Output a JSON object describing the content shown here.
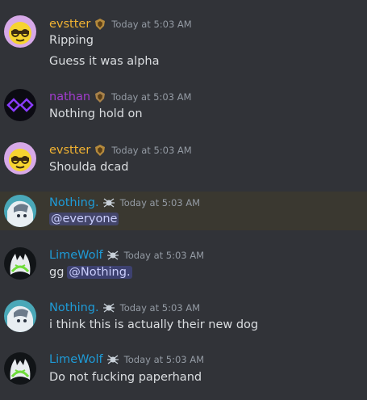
{
  "colors": {
    "background": "#313338",
    "mention_highlight": "#3a3830",
    "mention_pill_bg": "#3c4270",
    "mention_text": "#c9cdfb",
    "evstter": "#f0b232",
    "nathan": "#a23cce",
    "nothing": "#1e9bd7",
    "limewolf": "#1e9bd7",
    "timestamp": "#949ba4",
    "text": "#dbdee1"
  },
  "messages": [
    {
      "user": "evstter",
      "timestamp": "Today at 5:03 AM",
      "avatar_icon": "yellow-sunglasses-face-icon",
      "badge_icon": "crest-badge-icon",
      "lines": [
        "Ripping",
        "Guess it was alpha"
      ]
    },
    {
      "user": "nathan",
      "timestamp": "Today at 5:03 AM",
      "avatar_icon": "purple-double-diamond-icon",
      "badge_icon": "crest-badge-icon",
      "lines": [
        "Nothing hold on"
      ]
    },
    {
      "user": "evstter",
      "timestamp": "Today at 5:03 AM",
      "avatar_icon": "yellow-sunglasses-face-icon",
      "badge_icon": "crest-badge-icon",
      "lines": [
        "Shoulda dcad"
      ]
    },
    {
      "user": "Nothing.",
      "timestamp": "Today at 5:03 AM",
      "avatar_icon": "anime-character-icon",
      "badge_icon": "spider-badge-icon",
      "mention": "@everyone"
    },
    {
      "user": "LimeWolf",
      "timestamp": "Today at 5:03 AM",
      "avatar_icon": "green-wolf-icon",
      "badge_icon": "spider-badge-icon",
      "text_before_mention": "gg",
      "mention": "@Nothing."
    },
    {
      "user": "Nothing.",
      "timestamp": "Today at 5:03 AM",
      "avatar_icon": "anime-character-icon",
      "badge_icon": "spider-badge-icon",
      "lines": [
        "i think this is actually their new dog"
      ]
    },
    {
      "user": "LimeWolf",
      "timestamp": "Today at 5:03 AM",
      "avatar_icon": "green-wolf-icon",
      "badge_icon": "spider-badge-icon",
      "lines": [
        "Do not fucking paperhand"
      ]
    }
  ]
}
